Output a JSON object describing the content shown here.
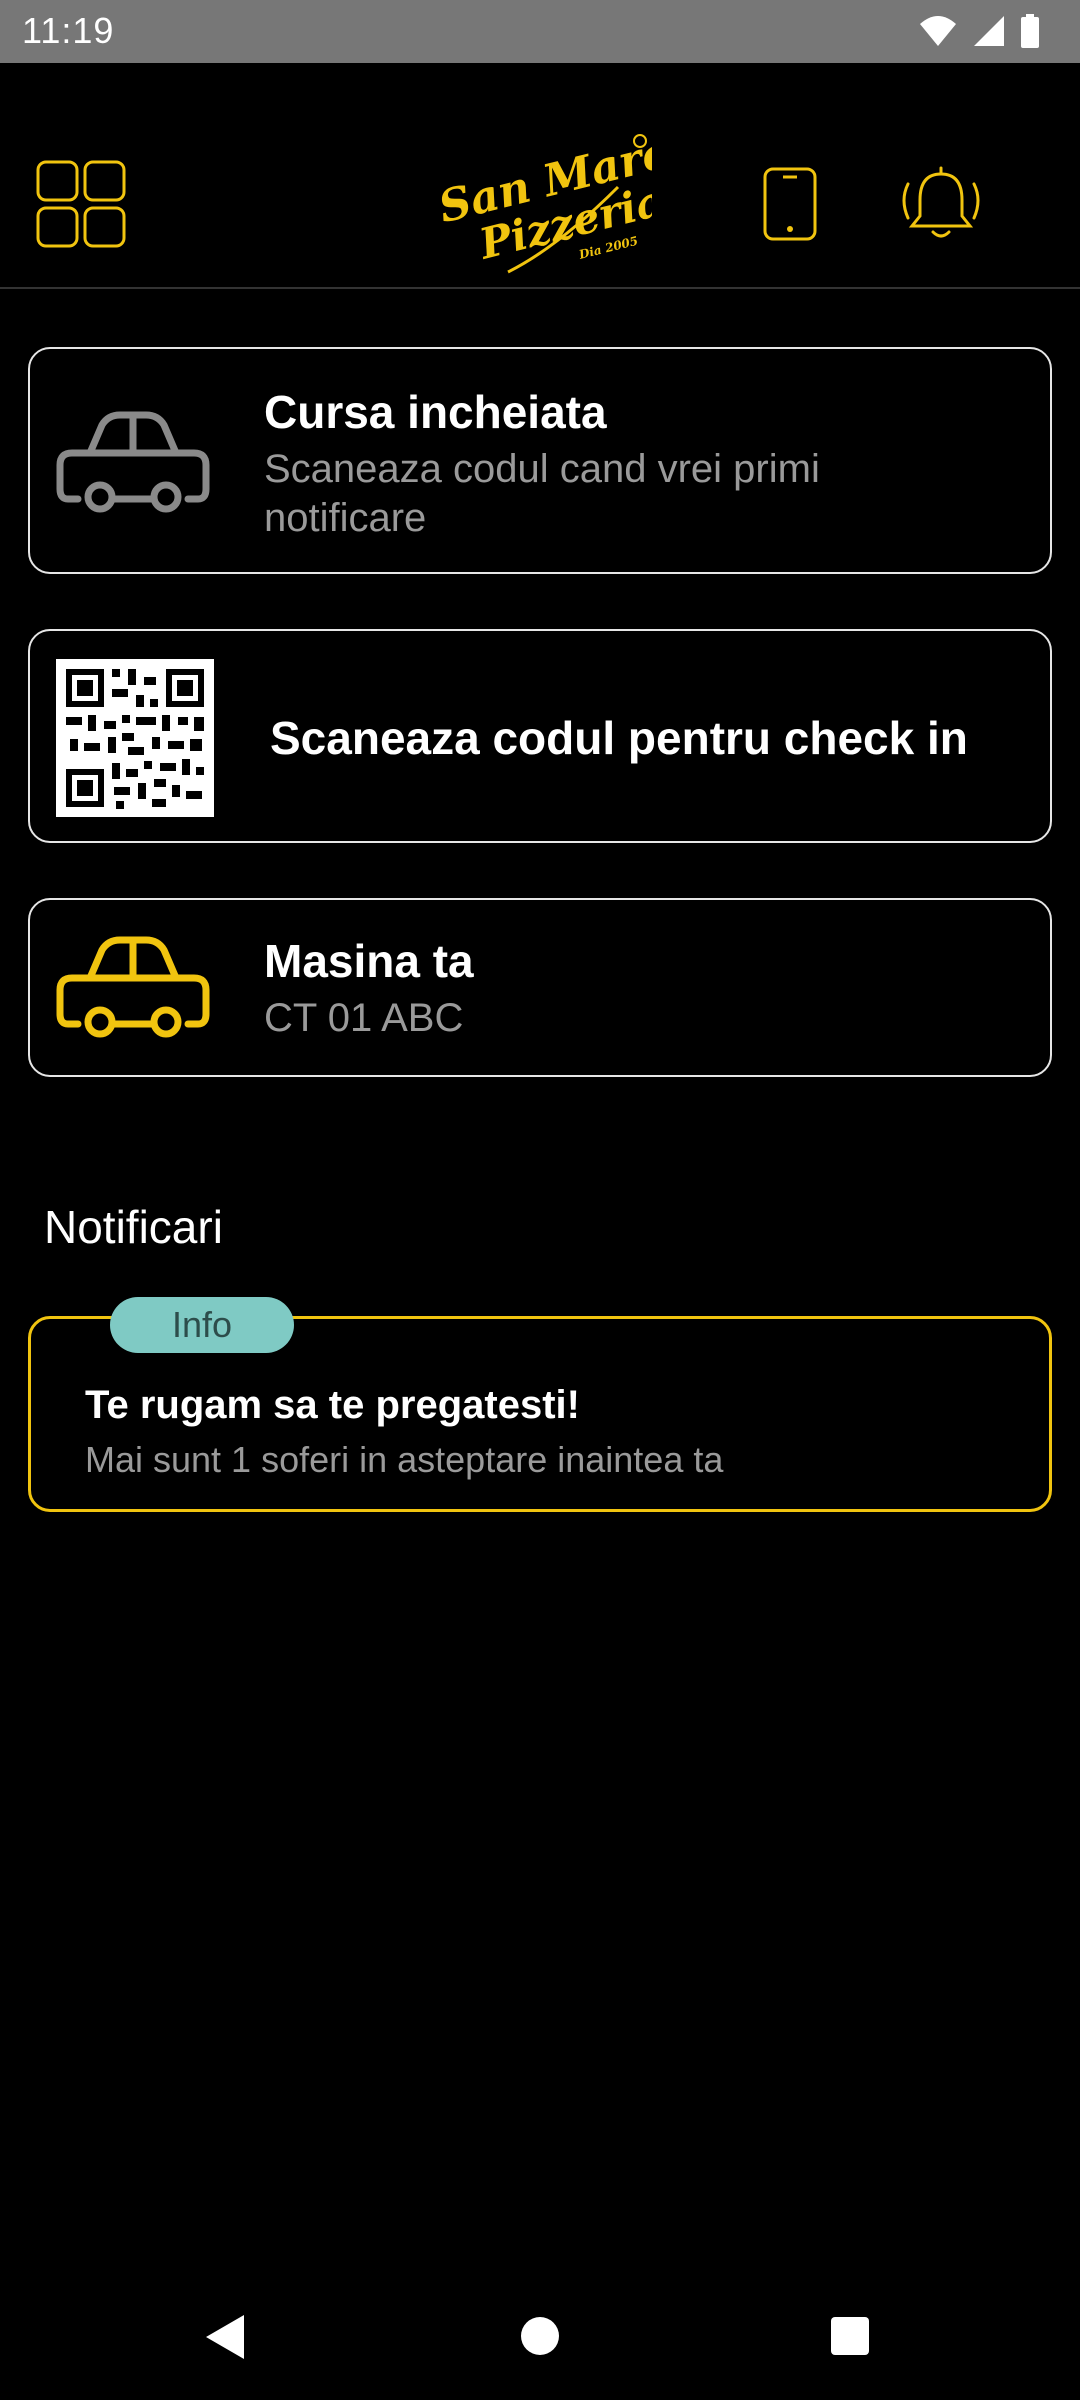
{
  "status_bar": {
    "time": "11:19"
  },
  "header": {
    "logo": {
      "line1": "San Marco",
      "line2": "Pizzeria",
      "since": "Dia 2005"
    }
  },
  "cards": [
    {
      "title": "Cursa incheiata",
      "subtitle": "Scaneaza codul cand vrei primi notificare",
      "icon": "car-outline-gray-icon"
    },
    {
      "title": "Scaneaza codul pentru check in",
      "icon": "qr-code-icon"
    },
    {
      "title": "Masina ta",
      "subtitle": "CT 01 ABC",
      "icon": "car-outline-yellow-icon"
    }
  ],
  "notifications": {
    "heading": "Notificari",
    "items": [
      {
        "badge": "Info",
        "title": "Te rugam sa te pregatesti!",
        "message": "Mai sunt 1 soferi in asteptare inaintea ta"
      }
    ]
  },
  "colors": {
    "accent": "#f1c40f",
    "background": "#000000",
    "muted": "#9a9a9a",
    "badge": "#7fcac4"
  }
}
